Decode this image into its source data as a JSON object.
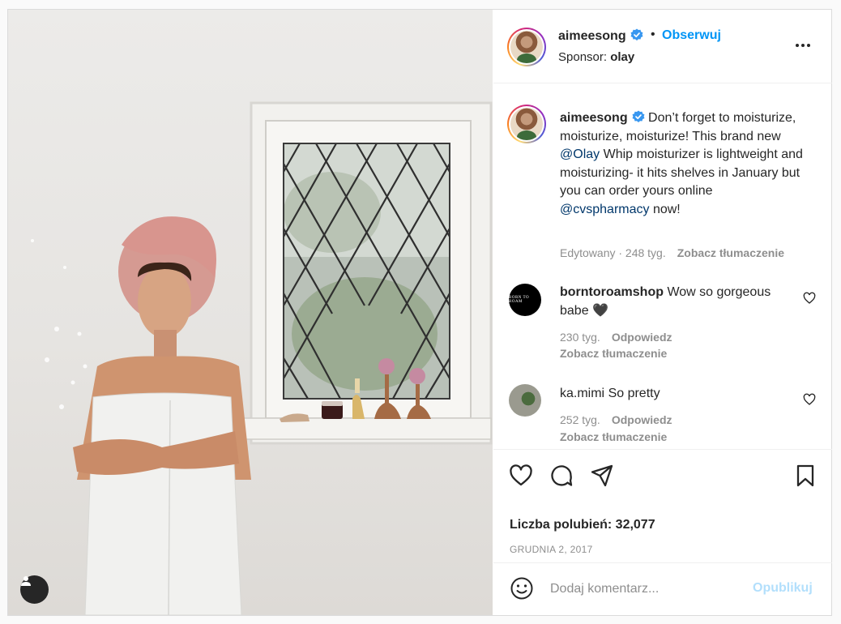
{
  "post": {
    "username": "aimeesong",
    "follow_label": "Obserwuj",
    "separator": "•",
    "sponsor_label": "Sponsor:",
    "sponsor_name": "olay",
    "caption": {
      "username": "aimeesong",
      "text_1": "Don’t forget to moisturize, moisturize, moisturize! This brand new ",
      "mention_1": "@Olay",
      "text_2": " Whip moisturizer is lightweight and moisturizing- it hits shelves in January but you can order yours online ",
      "mention_2": "@cvspharmacy",
      "text_3": " now!",
      "meta": "Edytowany · 248 tyg.",
      "translate": "Zobacz tłumaczenie"
    },
    "comments": [
      {
        "username": "borntoroamshop",
        "avatar_text": "BORN TO ROAM",
        "text": "Wow so gorgeous babe 🖤",
        "time": "230 tyg.",
        "reply": "Odpowiedz",
        "translate": "Zobacz tłumaczenie"
      },
      {
        "username": "ka.mimi",
        "text": "So pretty",
        "time": "252 tyg.",
        "reply": "Odpowiedz",
        "translate": "Zobacz tłumaczenie"
      }
    ],
    "likes": "Liczba polubień: 32,077",
    "date": "GRUDNIA 2, 2017",
    "comment_placeholder": "Dodaj komentarz...",
    "publish_label": "Opublikuj"
  },
  "icons": {
    "header": [
      "verified-badge-icon",
      "more-options-icon"
    ],
    "actions": [
      "heart-icon",
      "comment-icon",
      "share-icon",
      "bookmark-icon"
    ],
    "comment_box": [
      "emoji-icon"
    ],
    "photo": [
      "user-tag-icon"
    ]
  },
  "colors": {
    "accent": "#0095f6",
    "mention": "#00376b",
    "muted": "#8e8e8e",
    "publish_disabled": "#b2dffc"
  }
}
